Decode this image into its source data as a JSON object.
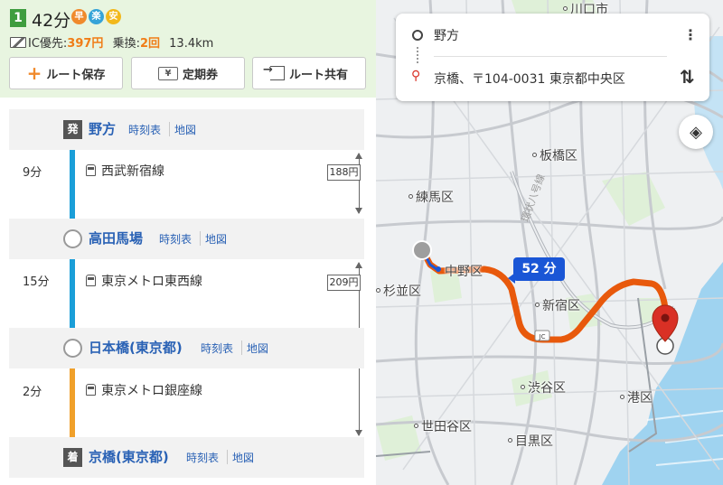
{
  "route": {
    "rank": "1",
    "duration": "42分",
    "badges": [
      "早",
      "楽",
      "安"
    ],
    "ic_label": "IC優先:",
    "fare": "397円",
    "transfer_label": "乗換:",
    "transfers": "2回",
    "distance": "13.4km",
    "colors": {
      "accent": "#f07d17",
      "link": "#2a62b5",
      "line1": "#1a9ed8",
      "line3": "#f0a02a"
    }
  },
  "actions": {
    "save": "ルート保存",
    "pass": "定期券",
    "share": "ルート共有",
    "pass_icon": "¥"
  },
  "stations": [
    {
      "tag": "発",
      "name": "野方",
      "timetable": "時刻表",
      "map": "地図"
    },
    {
      "name": "高田馬場",
      "timetable": "時刻表",
      "map": "地図"
    },
    {
      "name": "日本橋(東京都)",
      "timetable": "時刻表",
      "map": "地図"
    },
    {
      "tag": "着",
      "name": "京橋(東京都)",
      "timetable": "時刻表",
      "map": "地図"
    }
  ],
  "segments": [
    {
      "minutes": "9分",
      "line": "西武新宿線",
      "fare": "188円"
    },
    {
      "minutes": "15分",
      "line": "東京メトロ東西線",
      "fare": "209円"
    },
    {
      "minutes": "2分",
      "line": "東京メトロ銀座線"
    }
  ],
  "map": {
    "origin": "野方",
    "destination": "京橋、〒104-0031 東京都中央区",
    "travel_time": "52 分",
    "jc_label": "JC",
    "labels": [
      "川口市",
      "板橋区",
      "練馬区",
      "中野区",
      "杉並区",
      "新宿区",
      "渋谷区",
      "港区",
      "世田谷区",
      "目黒区"
    ],
    "road_label": "環状八号線",
    "route_color": "#e8590c",
    "water_color": "#9fd3f0"
  }
}
